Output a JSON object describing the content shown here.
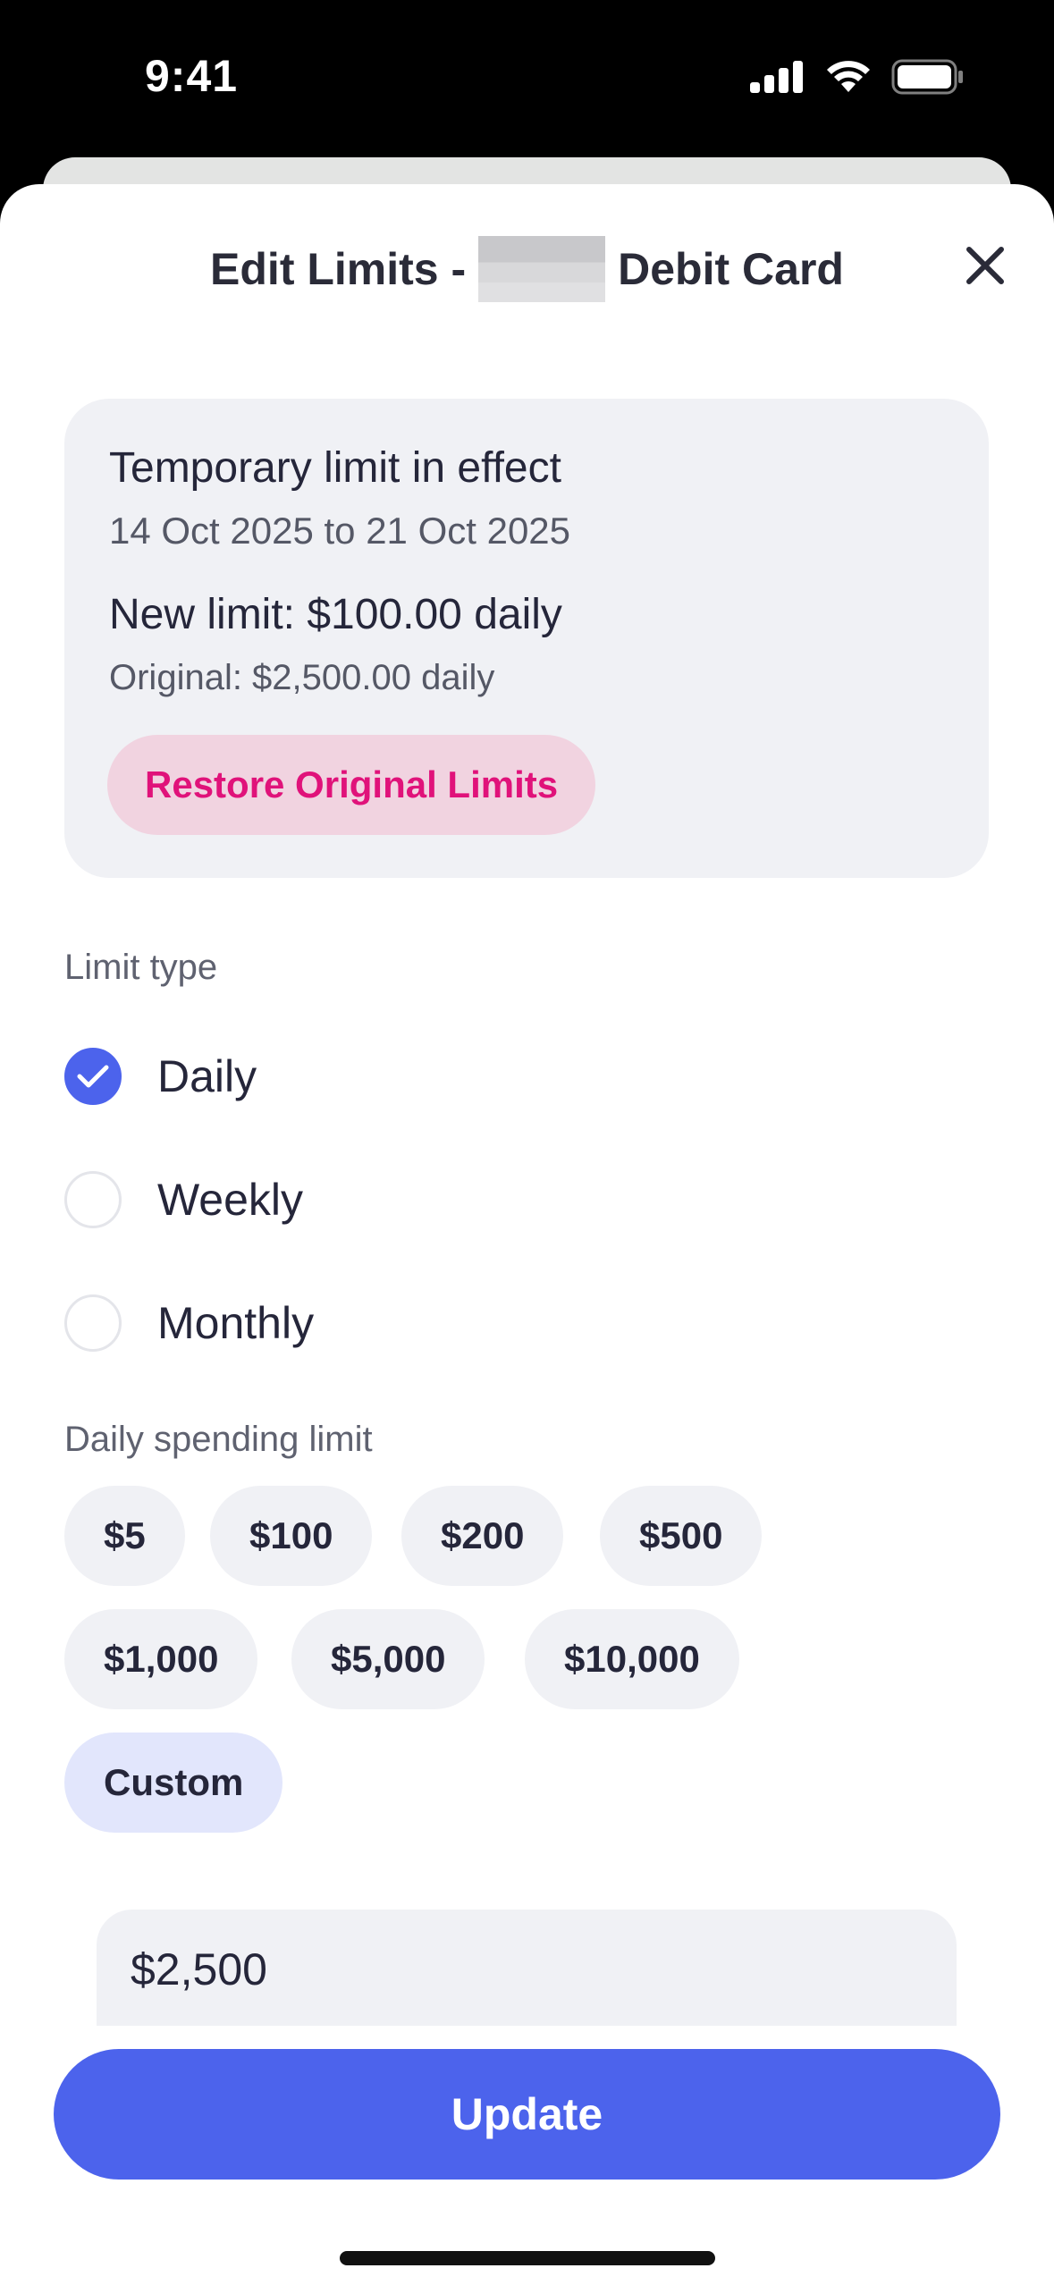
{
  "status_bar": {
    "time": "9:41"
  },
  "header": {
    "title_prefix": "Edit Limits -",
    "title_suffix": "Debit Card"
  },
  "temporary_limit": {
    "title": "Temporary limit in effect",
    "dates": "14 Oct 2025 to 21 Oct 2025",
    "new_limit": "New limit: $100.00 daily",
    "original": "Original: $2,500.00 daily",
    "restore_label": "Restore Original Limits"
  },
  "limit_type": {
    "label": "Limit type",
    "options": [
      "Daily",
      "Weekly",
      "Monthly"
    ],
    "selected": "Daily"
  },
  "spending_limit": {
    "label": "Daily spending limit",
    "chips": [
      "$5",
      "$100",
      "$200",
      "$500",
      "$1,000",
      "$5,000",
      "$10,000",
      "Custom"
    ],
    "selected": "Custom"
  },
  "custom_amount": {
    "value": "$2,500"
  },
  "update_label": "Update",
  "colors": {
    "accent": "#4c63ec",
    "restore_text": "#e0127a",
    "restore_bg": "#f1d3e0",
    "card_bg": "#f0f1f5"
  }
}
